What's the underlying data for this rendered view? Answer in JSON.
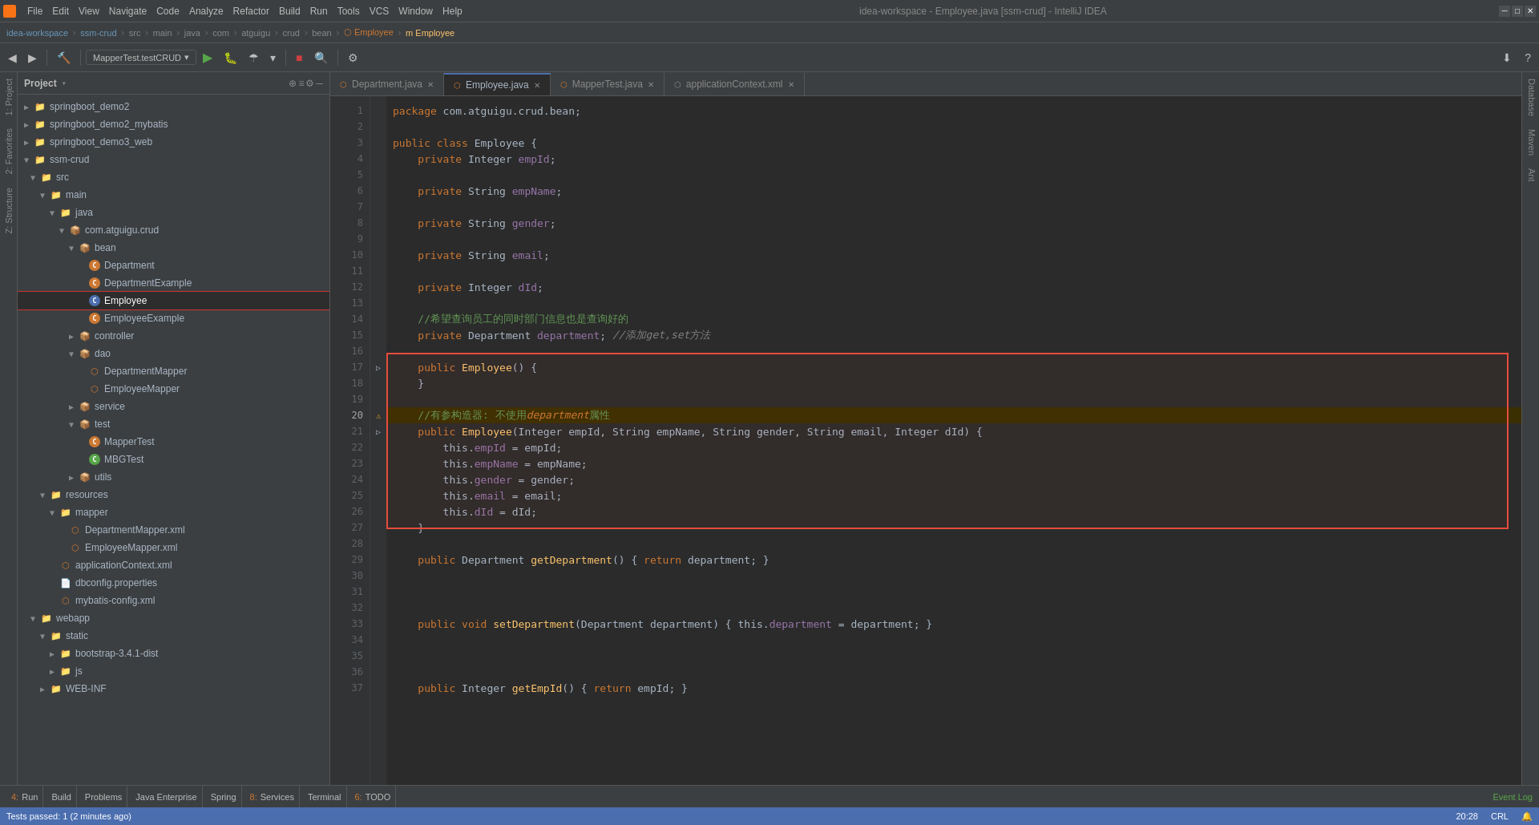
{
  "window": {
    "title": "idea-workspace - Employee.java [ssm-crud] - IntelliJ IDEA",
    "minimize": "─",
    "maximize": "□",
    "close": "✕"
  },
  "menubar": {
    "items": [
      "File",
      "Edit",
      "View",
      "Navigate",
      "Code",
      "Analyze",
      "Refactor",
      "Build",
      "Run",
      "Tools",
      "VCS",
      "Window",
      "Help"
    ]
  },
  "breadcrumb": {
    "items": [
      "idea-workspace",
      "ssm-crud",
      "src",
      "main",
      "java",
      "com",
      "atguigu",
      "crud",
      "bean",
      "Employee",
      "Employee"
    ]
  },
  "run_config": {
    "name": "MapperTest.testCRUD"
  },
  "tabs": [
    {
      "label": "Department.java",
      "active": false,
      "modified": false
    },
    {
      "label": "Employee.java",
      "active": true,
      "modified": false
    },
    {
      "label": "MapperTest.java",
      "active": false,
      "modified": false
    },
    {
      "label": "applicationContext.xml",
      "active": false,
      "modified": false
    }
  ],
  "project_panel": {
    "title": "Project",
    "tree": [
      {
        "level": 0,
        "type": "folder",
        "label": "springboot_demo2",
        "expanded": false
      },
      {
        "level": 0,
        "type": "folder",
        "label": "springboot_demo2_mybatis",
        "expanded": false
      },
      {
        "level": 0,
        "type": "folder",
        "label": "springboot_demo3_web",
        "expanded": false
      },
      {
        "level": 0,
        "type": "folder",
        "label": "ssm-crud",
        "expanded": true
      },
      {
        "level": 1,
        "type": "folder",
        "label": "src",
        "expanded": true
      },
      {
        "level": 2,
        "type": "folder",
        "label": "main",
        "expanded": true
      },
      {
        "level": 3,
        "type": "folder",
        "label": "java",
        "expanded": true
      },
      {
        "level": 4,
        "type": "folder",
        "label": "com.atguigu.crud",
        "expanded": true
      },
      {
        "level": 5,
        "type": "folder",
        "label": "bean",
        "expanded": true
      },
      {
        "level": 6,
        "type": "java",
        "label": "Department"
      },
      {
        "level": 6,
        "type": "java",
        "label": "DepartmentExample"
      },
      {
        "level": 6,
        "type": "java",
        "label": "Employee",
        "selected": true,
        "highlighted": true
      },
      {
        "level": 6,
        "type": "java",
        "label": "EmployeeExample"
      },
      {
        "level": 5,
        "type": "folder",
        "label": "controller",
        "expanded": false
      },
      {
        "level": 5,
        "type": "folder",
        "label": "dao",
        "expanded": true
      },
      {
        "level": 6,
        "type": "mapper",
        "label": "DepartmentMapper"
      },
      {
        "level": 6,
        "type": "mapper",
        "label": "EmployeeMapper"
      },
      {
        "level": 5,
        "type": "folder",
        "label": "service",
        "expanded": false
      },
      {
        "level": 5,
        "type": "folder",
        "label": "test",
        "expanded": true
      },
      {
        "level": 6,
        "type": "java",
        "label": "MapperTest"
      },
      {
        "level": 6,
        "type": "java-g",
        "label": "MBGTest"
      },
      {
        "level": 5,
        "type": "folder",
        "label": "utils",
        "expanded": false
      },
      {
        "level": 2,
        "type": "folder",
        "label": "resources",
        "expanded": true
      },
      {
        "level": 3,
        "type": "folder",
        "label": "mapper",
        "expanded": true
      },
      {
        "level": 4,
        "type": "xml",
        "label": "DepartmentMapper.xml"
      },
      {
        "level": 4,
        "type": "xml",
        "label": "EmployeeMapper.xml"
      },
      {
        "level": 3,
        "type": "xml",
        "label": "applicationContext.xml"
      },
      {
        "level": 3,
        "type": "props",
        "label": "dbconfig.properties"
      },
      {
        "level": 3,
        "type": "xml",
        "label": "mybatis-config.xml"
      },
      {
        "level": 1,
        "type": "folder",
        "label": "webapp",
        "expanded": true
      },
      {
        "level": 2,
        "type": "folder",
        "label": "static",
        "expanded": true
      },
      {
        "level": 3,
        "type": "folder",
        "label": "bootstrap-3.4.1-dist",
        "expanded": false
      },
      {
        "level": 3,
        "type": "folder",
        "label": "js",
        "expanded": false
      },
      {
        "level": 2,
        "type": "folder",
        "label": "WEB-INF",
        "expanded": false
      }
    ]
  },
  "code": {
    "lines": [
      {
        "num": 1,
        "content": "package com.atguigu.crud.bean;"
      },
      {
        "num": 2,
        "content": ""
      },
      {
        "num": 3,
        "content": "public class Employee {"
      },
      {
        "num": 4,
        "content": "    private Integer empId;"
      },
      {
        "num": 5,
        "content": ""
      },
      {
        "num": 6,
        "content": "    private String empName;"
      },
      {
        "num": 7,
        "content": ""
      },
      {
        "num": 8,
        "content": "    private String gender;"
      },
      {
        "num": 9,
        "content": ""
      },
      {
        "num": 10,
        "content": "    private String email;"
      },
      {
        "num": 11,
        "content": ""
      },
      {
        "num": 12,
        "content": "    private Integer dId;"
      },
      {
        "num": 13,
        "content": ""
      },
      {
        "num": 14,
        "content": "    //希望查询员工的同时部门信息也是查询好的"
      },
      {
        "num": 15,
        "content": "    private Department department; //添加get,set方法"
      },
      {
        "num": 16,
        "content": ""
      },
      {
        "num": 17,
        "content": "    public Employee() {",
        "highlighted": true
      },
      {
        "num": 18,
        "content": "    }",
        "highlighted": true
      },
      {
        "num": 19,
        "content": "",
        "highlighted": true
      },
      {
        "num": 20,
        "content": "    //有参构造器: 不使用department属性",
        "highlighted": true,
        "warning": true
      },
      {
        "num": 21,
        "content": "    public Employee(Integer empId, String empName, String gender, String email, Integer dId) {",
        "highlighted": true
      },
      {
        "num": 22,
        "content": "        this.empId = empId;",
        "highlighted": true
      },
      {
        "num": 23,
        "content": "        this.empName = empName;",
        "highlighted": true
      },
      {
        "num": 24,
        "content": "        this.gender = gender;",
        "highlighted": true
      },
      {
        "num": 25,
        "content": "        this.email = email;",
        "highlighted": true
      },
      {
        "num": 26,
        "content": "        this.dId = dId;",
        "highlighted": true
      },
      {
        "num": 27,
        "content": "    }",
        "highlighted": true
      },
      {
        "num": 28,
        "content": ""
      },
      {
        "num": 29,
        "content": "    public Department getDepartment() { return department; }"
      },
      {
        "num": 30,
        "content": ""
      },
      {
        "num": 31,
        "content": ""
      },
      {
        "num": 32,
        "content": ""
      },
      {
        "num": 33,
        "content": "    public void setDepartment(Department department) { this.department = department; }"
      },
      {
        "num": 34,
        "content": ""
      },
      {
        "num": 35,
        "content": ""
      },
      {
        "num": 36,
        "content": ""
      },
      {
        "num": 37,
        "content": "    public Integer getEmpId() { return empId; }"
      }
    ]
  },
  "bottom_tabs": [
    {
      "num": "4",
      "label": "Run"
    },
    {
      "num": "",
      "label": "Build"
    },
    {
      "num": "",
      "label": "Problems"
    },
    {
      "num": "",
      "label": "Java Enterprise"
    },
    {
      "num": "",
      "label": "Spring"
    },
    {
      "num": "8",
      "label": "Services"
    },
    {
      "num": "",
      "label": "Terminal"
    },
    {
      "num": "6",
      "label": "TODO"
    }
  ],
  "status_bar": {
    "message": "Tests passed: 1 (2 minutes ago)",
    "position": "20:28",
    "encoding": "CRL",
    "event_log": "Event Log"
  },
  "right_tabs": [
    "Database",
    "Maven",
    "Ant"
  ],
  "left_tabs": [
    "1: Project",
    "2: Favorites",
    "Z: Structure"
  ]
}
